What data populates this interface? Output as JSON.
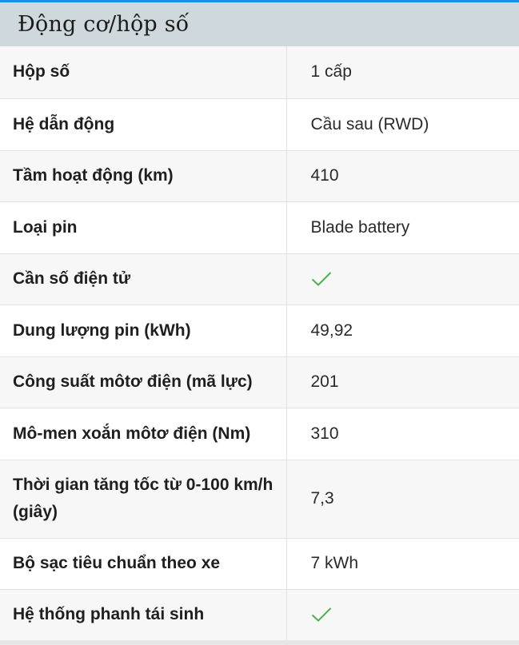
{
  "section": {
    "title": "Động cơ/hộp số"
  },
  "rows": [
    {
      "label": "Hộp số",
      "value": "1 cấp"
    },
    {
      "label": "Hệ dẫn động",
      "value": "Cầu sau (RWD)"
    },
    {
      "label": "Tầm hoạt động (km)",
      "value": "410"
    },
    {
      "label": "Loại pin",
      "value": "Blade battery"
    },
    {
      "label": "Cần số điện tử",
      "value": "",
      "icon": "check-icon"
    },
    {
      "label": "Dung lượng pin (kWh)",
      "value": "49,92"
    },
    {
      "label": "Công suất môtơ điện (mã lực)",
      "value": "201"
    },
    {
      "label": "Mô-men xoắn môtơ điện (Nm)",
      "value": "310"
    },
    {
      "label": "Thời gian tăng tốc từ 0-100 km/h (giây)",
      "value": "7,3"
    },
    {
      "label": "Bộ sạc tiêu chuẩn theo xe",
      "value": "7 kWh"
    },
    {
      "label": "Hệ thống phanh tái sinh",
      "value": "",
      "icon": "check-icon"
    }
  ],
  "colors": {
    "accent_top_border": "#1a8fe0",
    "header_bg": "#cfd8dc",
    "row_alt_bg": "#f7f7f7",
    "check_color": "#4caf50"
  }
}
